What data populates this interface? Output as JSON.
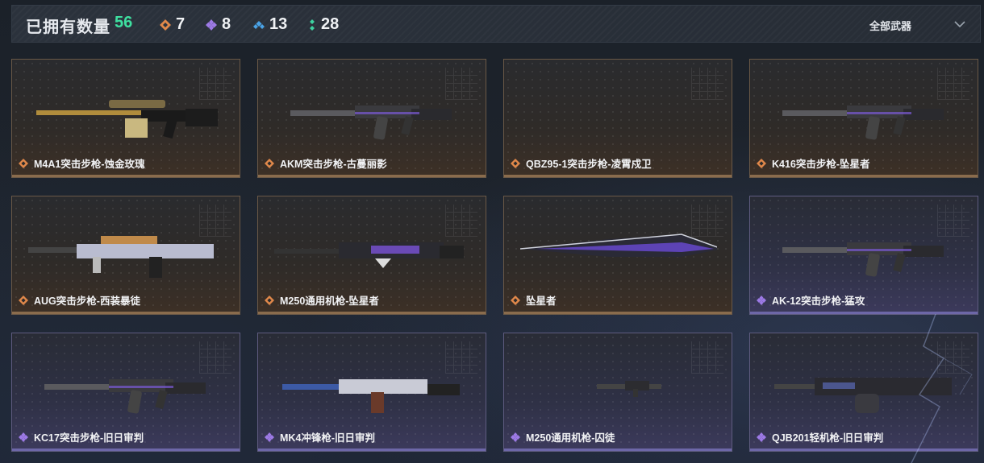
{
  "header": {
    "title": "已拥有数量",
    "total": "56",
    "rarity_counts": [
      {
        "icon": "orange-diamond-icon",
        "color": "#e0884a",
        "value": "7"
      },
      {
        "icon": "purple-diamond-icon",
        "color": "#9d7ae6",
        "value": "8"
      },
      {
        "icon": "blue-diamond-icon",
        "color": "#4aa3e6",
        "value": "13"
      },
      {
        "icon": "green-diamond-icon",
        "color": "#3ed1a0",
        "value": "28"
      }
    ],
    "filter_label": "全部武器"
  },
  "colors": {
    "orange": "#e0884a",
    "purple": "#9d7ae6"
  },
  "weapons": [
    {
      "name": "M4A1突击步枪-蚀金玫瑰",
      "rarity": "orange",
      "icon": "sniper-rifle-icon"
    },
    {
      "name": "AKM突击步枪-古蔓丽影",
      "rarity": "orange",
      "icon": "assault-rifle-icon"
    },
    {
      "name": "QBZ95-1突击步枪-凌霄戍卫",
      "rarity": "orange",
      "icon": ""
    },
    {
      "name": "K416突击步枪-坠星者",
      "rarity": "orange",
      "icon": "assault-rifle-icon"
    },
    {
      "name": "AUG突击步枪-西装暴徒",
      "rarity": "orange",
      "icon": "bullpup-rifle-icon"
    },
    {
      "name": "M250通用机枪-坠星者",
      "rarity": "orange",
      "icon": "machine-gun-icon"
    },
    {
      "name": "坠星者",
      "rarity": "orange",
      "icon": "blade-icon"
    },
    {
      "name": "AK-12突击步枪-猛攻",
      "rarity": "purple",
      "icon": "assault-rifle-icon"
    },
    {
      "name": "KC17突击步枪-旧日审判",
      "rarity": "purple",
      "icon": "assault-rifle-icon"
    },
    {
      "name": "MK4冲锋枪-旧日审判",
      "rarity": "purple",
      "icon": "smg-icon"
    },
    {
      "name": "M250通用机枪-囚徒",
      "rarity": "purple",
      "icon": "small-gun-icon"
    },
    {
      "name": "QJB201轻机枪-旧日审判",
      "rarity": "purple",
      "icon": "light-machine-gun-icon"
    }
  ]
}
